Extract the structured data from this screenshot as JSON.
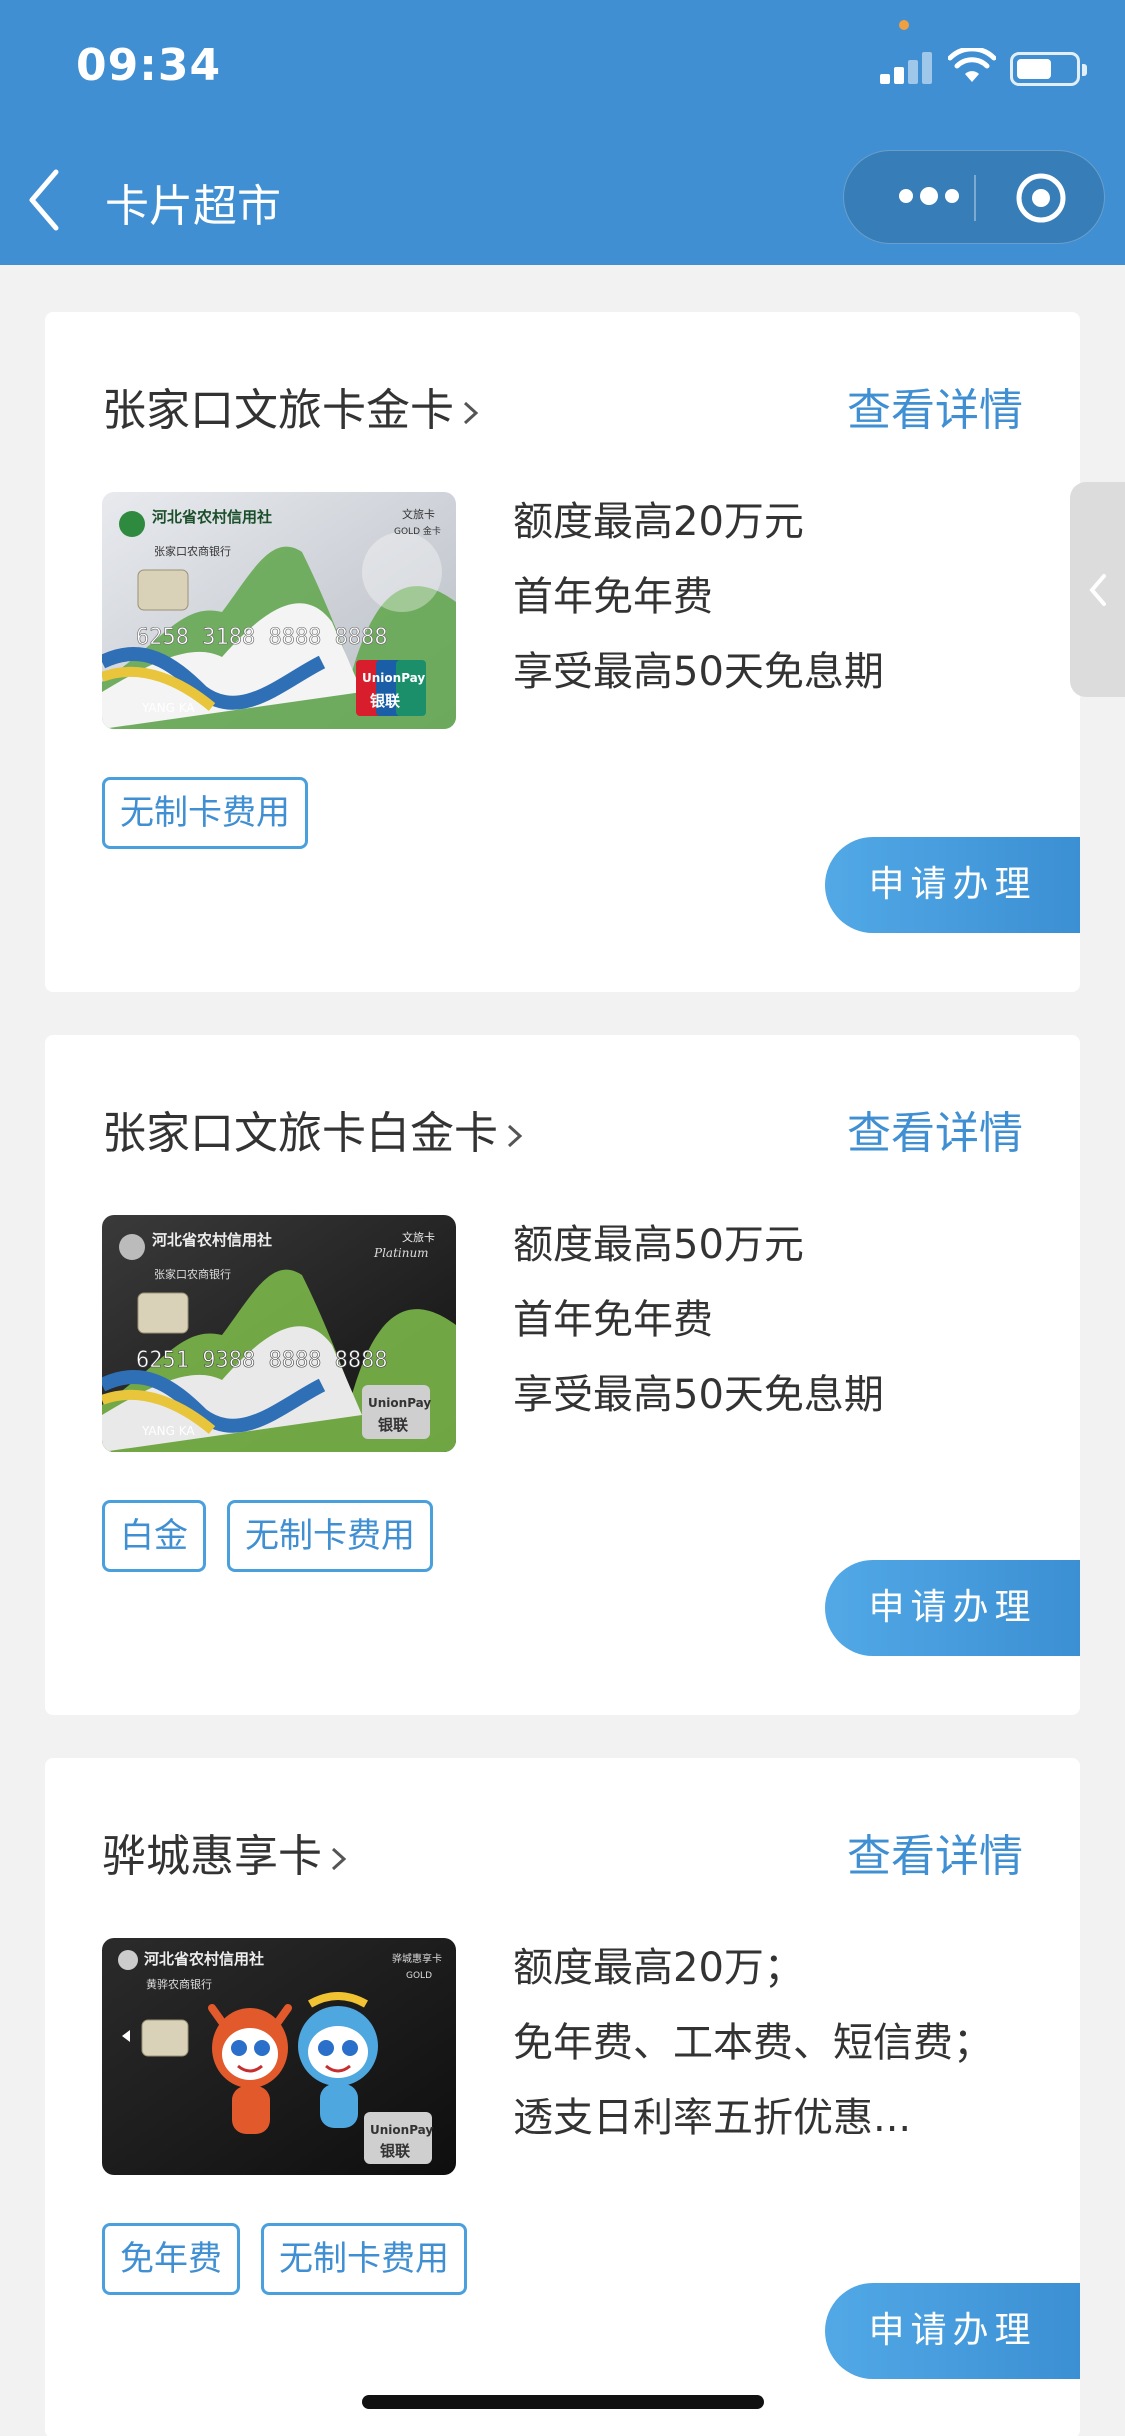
{
  "status_bar": {
    "time": "09:34",
    "battery_level": 0.55
  },
  "nav": {
    "title": "卡片超市"
  },
  "cards": [
    {
      "title": "张家口文旅卡金卡",
      "detail_label": "查看详情",
      "benefits": [
        "额度最高20万元",
        "首年免年费",
        "享受最高50天免息期"
      ],
      "tags": [
        "无制卡费用"
      ],
      "apply_label": "申请办理",
      "image": {
        "bank_name": "河北省农村信用社",
        "branch": "张家口农商银行",
        "card_type": "文旅卡",
        "tier": "GOLD 金卡",
        "number": "6258 3188 8888 8888",
        "holder": "YANG KA",
        "network": "UnionPay",
        "network_cn": "银联",
        "theme": "silver"
      }
    },
    {
      "title": "张家口文旅卡白金卡",
      "detail_label": "查看详情",
      "benefits": [
        "额度最高50万元",
        "首年免年费",
        "享受最高50天免息期"
      ],
      "tags": [
        "白金",
        "无制卡费用"
      ],
      "apply_label": "申请办理",
      "image": {
        "bank_name": "河北省农村信用社",
        "branch": "张家口农商银行",
        "card_type": "文旅卡",
        "tier": "Platinum",
        "number": "6251 9388 8888 8888",
        "holder": "YANG KA",
        "network": "UnionPay",
        "network_cn": "银联",
        "theme": "black"
      }
    },
    {
      "title": "骅城惠享卡",
      "detail_label": "查看详情",
      "benefits": [
        "额度最高20万；",
        "免年费、工本费、短信费；",
        "透支日利率五折优惠..."
      ],
      "tags": [
        "免年费",
        "无制卡费用"
      ],
      "apply_label": "申请办理",
      "image": {
        "bank_name": "河北省农村信用社",
        "branch": "黄骅农商银行",
        "card_type": "骅城惠享卡",
        "tier": "GOLD",
        "network": "UnionPay",
        "network_cn": "银联",
        "theme": "dark"
      }
    }
  ],
  "colors": {
    "primary": "#3f8fd2",
    "background": "#f2f2f2"
  }
}
